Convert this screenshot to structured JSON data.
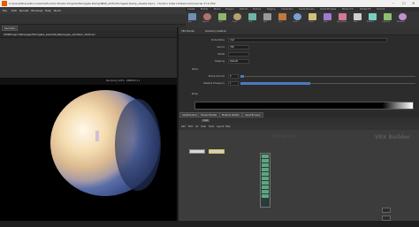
{
  "window": {
    "title": "C:/Users/Shane/Documents/Houdini Shader Projects/Farmgate Ramp/NEW_ADTL/Farmgate Ramp_Assets.hipnc - Houdini Indie Limited-Commercial 17.0.352",
    "min": "–",
    "max": "☐",
    "close": "✕"
  },
  "menubar": {
    "items": [
      "File",
      "Edit",
      "Render",
      "Windows",
      "Help",
      "Build"
    ]
  },
  "shelf": {
    "tabs": [
      "Create",
      "Modify",
      "Model",
      "Polygon",
      "Deform",
      "Texture",
      "Rigging",
      "Characters",
      "Guide Process",
      "Guide Brushes",
      "Terrain FX",
      "Simple FX",
      "Volume"
    ],
    "tools": [
      "Box",
      "Sphere",
      "Tube",
      "Torus",
      "Grid",
      "Null",
      "Line",
      "Circle",
      "Curve",
      "Path",
      "Spray Paint",
      "Font",
      "Platonic",
      "L-System",
      "Metaball"
    ]
  },
  "left": {
    "tab": "Geometry",
    "path": "$HIP/Project Ramp/geo/Farmgate_assembly/Ramp/geo_sim/Stair_1003.exr",
    "viewport_status": "Rendering 100% · RENDER 2.1"
  },
  "params": {
    "header": "VEX Builder",
    "node": "standard_material",
    "rows": [
      {
        "label": "Node Name",
        "value": "mat"
      },
      {
        "label": "Source",
        "value": "VEX"
      },
      {
        "label": "Shade",
        "value": ""
      },
      {
        "label": "Mapping",
        "value": "Default"
      },
      {
        "label": "Noise",
        "value": ""
      },
      {
        "label": "Bump Amount",
        "value": "0"
      },
      {
        "label": "Relative Frequency",
        "value": "1"
      },
      {
        "label": "Ramp",
        "value": ""
      }
    ],
    "sliders": [
      0.02,
      0.4
    ],
    "ramp_label": "Ramp"
  },
  "network": {
    "tabs": [
      "/obj/Shader/A",
      "Shader Builder",
      "Material Palette",
      "Asset Browser"
    ],
    "path": "mat",
    "menu": [
      "Add",
      "Edit",
      "Go",
      "View",
      "Tools",
      "Layout",
      "Help"
    ],
    "watermark": "VEX Builder",
    "context": "VEX Builder"
  },
  "colors": {
    "accent": "#e65c00",
    "selection": "#d4c24a",
    "slider": "#4a7ac0"
  }
}
